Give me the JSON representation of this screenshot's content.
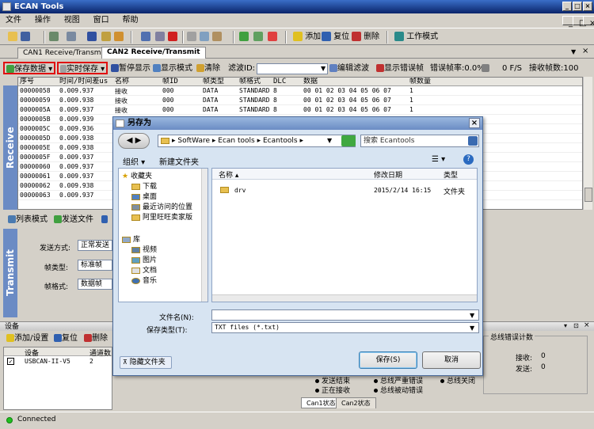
{
  "app": {
    "title": "ECAN Tools"
  },
  "menu": [
    "文件",
    "操作",
    "视图",
    "窗口",
    "帮助"
  ],
  "toolbar": {
    "add": "添加",
    "reset": "复位",
    "delete": "删除",
    "work_mode": "工作模式"
  },
  "tabs": [
    "CAN1 Receive/Transmit",
    "CAN2 Receive/Transmit"
  ],
  "subbar": {
    "save_data": "保存数据",
    "realtime_save": "实时保存",
    "pause": "暂停显示",
    "display_mode": "显示模式",
    "clear": "清除",
    "filter_id": "滤波ID:",
    "edit_filter": "编辑滤波",
    "show_error": "显示错误帧",
    "error_rate": "错误帧率:0.0%",
    "fps": "0 F/S",
    "recv_count": "接收帧数:100"
  },
  "receive_label": "Receive",
  "transmit_label": "Transmit",
  "grid": {
    "columns": [
      "序号",
      "时间/时间差us",
      "名称",
      "帧ID",
      "帧类型",
      "帧格式",
      "DLC",
      "数据",
      "帧数量"
    ],
    "rows": [
      [
        "00000058",
        "0.009.937",
        "接收",
        "000",
        "DATA",
        "STANDARD",
        "8",
        "00 01 02 03 04 05 06 07",
        "1"
      ],
      [
        "00000059",
        "0.009.938",
        "接收",
        "000",
        "DATA",
        "STANDARD",
        "8",
        "00 01 02 03 04 05 06 07",
        "1"
      ],
      [
        "0000005A",
        "0.009.937",
        "接收",
        "000",
        "DATA",
        "STANDARD",
        "8",
        "00 01 02 03 04 05 06 07",
        "1"
      ],
      [
        "0000005B",
        "0.009.939",
        "",
        "",
        "",
        "",
        "",
        "",
        ""
      ],
      [
        "0000005C",
        "0.009.936",
        "",
        "",
        "",
        "",
        "",
        "",
        ""
      ],
      [
        "0000005D",
        "0.009.938",
        "",
        "",
        "",
        "",
        "",
        "",
        ""
      ],
      [
        "0000005E",
        "0.009.938",
        "",
        "",
        "",
        "",
        "",
        "",
        ""
      ],
      [
        "0000005F",
        "0.009.937",
        "",
        "",
        "",
        "",
        "",
        "",
        ""
      ],
      [
        "00000060",
        "0.009.937",
        "",
        "",
        "",
        "",
        "",
        "",
        ""
      ],
      [
        "00000061",
        "0.009.937",
        "",
        "",
        "",
        "",
        "",
        "",
        ""
      ],
      [
        "00000062",
        "0.009.938",
        "",
        "",
        "",
        "",
        "",
        "",
        ""
      ],
      [
        "00000063",
        "0.009.937",
        "",
        "",
        "",
        "",
        "",
        "",
        ""
      ]
    ]
  },
  "midbar": {
    "list_mode": "列表模式",
    "send_file": "发送文件"
  },
  "transmit": {
    "send_mode_label": "发送方式:",
    "send_mode_value": "正常发送",
    "frame_type_label": "帧类型:",
    "frame_type_value": "标准帧",
    "frame_format_label": "帧格式:",
    "frame_format_value": "数据帧"
  },
  "device": {
    "title": "设备",
    "add": "添加/设置",
    "reset": "复位",
    "delete": "删除",
    "col_device": "设备",
    "col_channels": "通道数",
    "row_device": "USBCAN-II-V5",
    "row_channels": "2"
  },
  "status_panel": {
    "bus_error_count": "总线错误计数",
    "state_label": "态",
    "recv_label": "接收:",
    "recv_value": "0",
    "send_label": "发送:",
    "send_value": "0",
    "sending": "发送结束",
    "receiving": "正在接收",
    "bus_heavy_error": "总线严重错误",
    "bus_passive_error": "总线被动错误",
    "bus_close": "总线关闭",
    "tab1": "Can1状态",
    "tab2": "Can2状态"
  },
  "status_bar": {
    "text": "Connected"
  },
  "dialog": {
    "title": "另存为",
    "breadcrumb": [
      "SoftWare",
      "Ecan tools",
      "Ecantools"
    ],
    "search_placeholder": "搜索 Ecantools",
    "organize": "组织",
    "new_folder": "新建文件夹",
    "nav_favorites": "收藏夹",
    "nav_items": [
      "下载",
      "桌面",
      "最近访问的位置",
      "阿里旺旺卖家版"
    ],
    "nav_library": "库",
    "library_items": [
      "视频",
      "图片",
      "文档",
      "音乐"
    ],
    "col_name": "名称",
    "col_date": "修改日期",
    "col_type": "类型",
    "files": [
      {
        "name": "drv",
        "date": "2015/2/14 16:15",
        "type": "文件夹"
      }
    ],
    "filename_label": "文件名(N):",
    "filename_value": "",
    "filetype_label": "保存类型(T):",
    "filetype_value": "TXT files (*.txt)",
    "hide_folders": "隐藏文件夹",
    "save": "保存(S)",
    "cancel": "取消"
  }
}
